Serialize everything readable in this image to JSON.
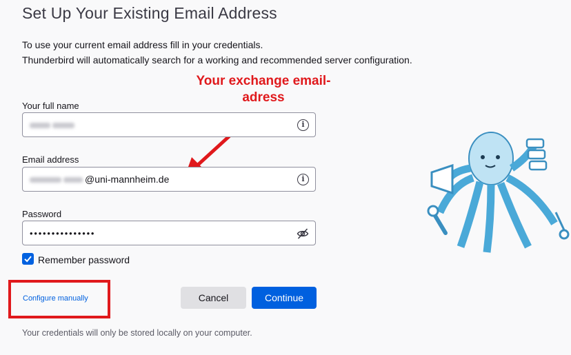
{
  "page": {
    "title": "Set Up Your Existing Email Address",
    "intro_line1": "To use your current email address fill in your credentials.",
    "intro_line2": "Thunderbird will automatically search for a working and recommended server configuration."
  },
  "annotation": {
    "text": "Your exchange email-adress",
    "color": "#e0191c"
  },
  "form": {
    "full_name": {
      "label": "Your full name",
      "value_visible": ""
    },
    "email": {
      "label": "Email address",
      "value_visible": "@uni-mannheim.de"
    },
    "password": {
      "label": "Password",
      "value_masked": "•••••••••••••••"
    },
    "remember": {
      "label": "Remember password",
      "checked": true
    }
  },
  "actions": {
    "configure_manually": "Configure manually",
    "cancel": "Cancel",
    "continue": "Continue"
  },
  "footer": {
    "note": "Your credentials will only be stored locally on your computer."
  },
  "icons": {
    "info": "info-icon",
    "eye_slash": "eye-slash-icon",
    "check": "check-icon",
    "mascot": "octopus-mascot-illustration"
  },
  "colors": {
    "accent": "#0060df",
    "annotation_red": "#e0191c",
    "mascot": "#4aa9d8"
  }
}
